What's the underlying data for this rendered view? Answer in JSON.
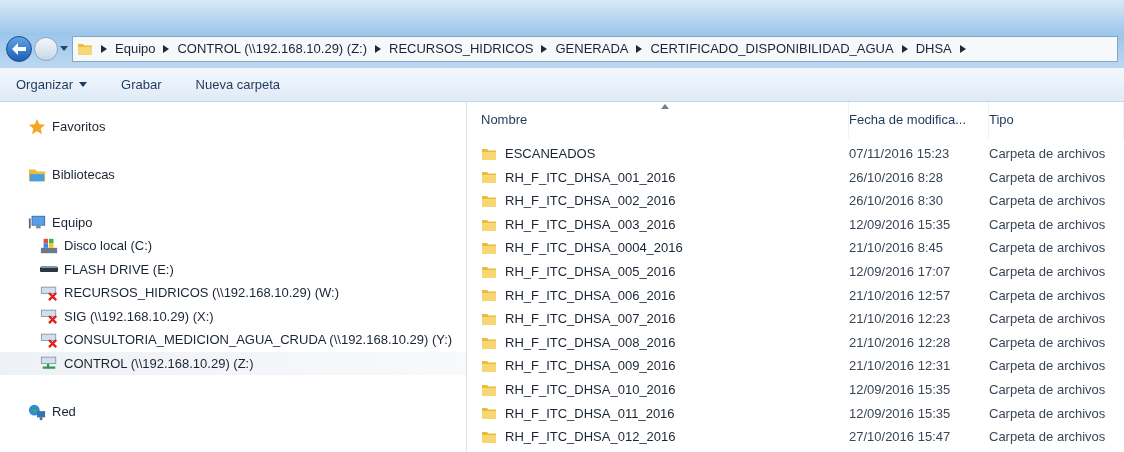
{
  "address_bar": {
    "path": [
      "Equipo",
      "CONTROL (\\\\192.168.10.29) (Z:)",
      "RECURSOS_HIDRICOS",
      "GENERADA",
      "CERTIFICADO_DISPONIBILIDAD_AGUA",
      "DHSA"
    ]
  },
  "toolbar": [
    {
      "label": "Organizar",
      "dropdown": true
    },
    {
      "label": "Grabar",
      "dropdown": false
    },
    {
      "label": "Nueva carpeta",
      "dropdown": false
    }
  ],
  "sidebar": [
    {
      "label": "Favoritos",
      "kind": "favorites"
    },
    {
      "label": "Bibliotecas",
      "kind": "libraries"
    },
    {
      "label": "Equipo",
      "kind": "computer",
      "children": [
        {
          "label": "Disco local (C:)",
          "kind": "local-disk",
          "selected": false
        },
        {
          "label": "FLASH DRIVE (E:)",
          "kind": "removable",
          "selected": false
        },
        {
          "label": "RECURSOS_HIDRICOS (\\\\192.168.10.29) (W:)",
          "kind": "network-drive",
          "connected": false,
          "selected": false
        },
        {
          "label": "SIG (\\\\192.168.10.29) (X:)",
          "kind": "network-drive",
          "connected": false,
          "selected": false
        },
        {
          "label": "CONSULTORIA_MEDICION_AGUA_CRUDA (\\\\192.168.10.29) (Y:)",
          "kind": "network-drive",
          "connected": false,
          "selected": false
        },
        {
          "label": "CONTROL (\\\\192.168.10.29) (Z:)",
          "kind": "network-drive",
          "connected": true,
          "selected": true
        }
      ]
    },
    {
      "label": "Red",
      "kind": "network"
    }
  ],
  "table": {
    "columns": [
      {
        "label": "Nombre",
        "sorted": true
      },
      {
        "label": "Fecha de modifica...",
        "sorted": false
      },
      {
        "label": "Tipo",
        "sorted": false
      }
    ],
    "rows": [
      [
        "ESCANEADOS",
        "07/11/2016 15:23",
        "Carpeta de archivos"
      ],
      [
        "RH_F_ITC_DHSA_001_2016",
        "26/10/2016 8:28",
        "Carpeta de archivos"
      ],
      [
        "RH_F_ITC_DHSA_002_2016",
        "26/10/2016 8:30",
        "Carpeta de archivos"
      ],
      [
        "RH_F_ITC_DHSA_003_2016",
        "12/09/2016 15:35",
        "Carpeta de archivos"
      ],
      [
        "RH_F_ITC_DHSA_0004_2016",
        "21/10/2016 8:45",
        "Carpeta de archivos"
      ],
      [
        "RH_F_ITC_DHSA_005_2016",
        "12/09/2016 17:07",
        "Carpeta de archivos"
      ],
      [
        "RH_F_ITC_DHSA_006_2016",
        "21/10/2016 12:57",
        "Carpeta de archivos"
      ],
      [
        "RH_F_ITC_DHSA_007_2016",
        "21/10/2016 12:23",
        "Carpeta de archivos"
      ],
      [
        "RH_F_ITC_DHSA_008_2016",
        "21/10/2016 12:28",
        "Carpeta de archivos"
      ],
      [
        "RH_F_ITC_DHSA_009_2016",
        "21/10/2016 12:31",
        "Carpeta de archivos"
      ],
      [
        "RH_F_ITC_DHSA_010_2016",
        "12/09/2016 15:35",
        "Carpeta de archivos"
      ],
      [
        "RH_F_ITC_DHSA_011_2016",
        "12/09/2016 15:35",
        "Carpeta de archivos"
      ],
      [
        "RH_F_ITC_DHSA_012_2016",
        "27/10/2016 15:47",
        "Carpeta de archivos"
      ]
    ]
  }
}
